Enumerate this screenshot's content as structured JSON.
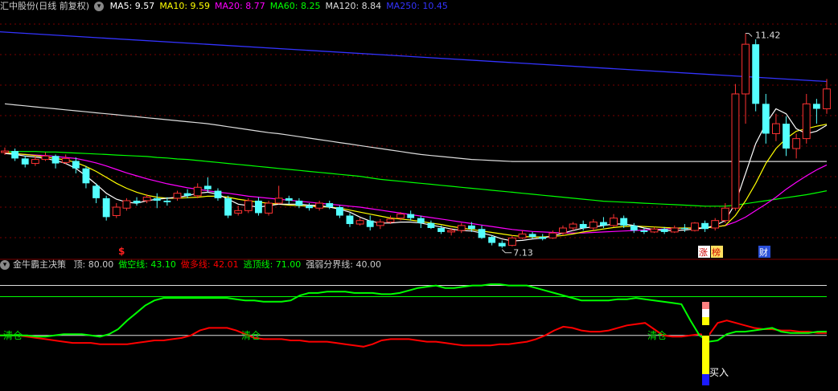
{
  "main_header": {
    "stock_title": "汇中股份(日线 前复权)",
    "ma_items": [
      {
        "label": "MA5: 9.57",
        "color": "#ffffff"
      },
      {
        "label": "MA10: 9.59",
        "color": "#ffff00"
      },
      {
        "label": "MA20: 8.77",
        "color": "#ff00ff"
      },
      {
        "label": "MA60: 8.25",
        "color": "#00ff00"
      },
      {
        "label": "MA120: 8.84",
        "color": "#dddddd"
      },
      {
        "label": "MA250: 10.45",
        "color": "#3333ff"
      }
    ]
  },
  "main_chart": {
    "high_label": "11.42",
    "low_label": "7.13",
    "markers": {
      "dollar": "$",
      "zhang": "涨",
      "bang": "榜",
      "cai": "财"
    },
    "colors": {
      "up": "#ff3232",
      "down": "#54ffff",
      "grid": "#7a0000"
    },
    "candles": [
      [
        9.02,
        9.05,
        9.12,
        8.97
      ],
      [
        9.05,
        8.9,
        9.1,
        8.85
      ],
      [
        8.9,
        8.78,
        8.96,
        8.72
      ],
      [
        8.8,
        8.88,
        8.95,
        8.75
      ],
      [
        8.88,
        8.95,
        9.02,
        8.85
      ],
      [
        8.95,
        8.8,
        8.98,
        8.7
      ],
      [
        8.82,
        8.9,
        8.98,
        8.78
      ],
      [
        8.85,
        8.7,
        8.92,
        8.6
      ],
      [
        8.7,
        8.4,
        8.75,
        8.3
      ],
      [
        8.35,
        8.1,
        8.4,
        8.0
      ],
      [
        8.1,
        7.72,
        8.15,
        7.65
      ],
      [
        7.75,
        7.92,
        8.0,
        7.7
      ],
      [
        7.9,
        8.05,
        8.1,
        7.85
      ],
      [
        8.05,
        8.0,
        8.12,
        7.95
      ],
      [
        8.05,
        8.12,
        8.18,
        8.0
      ],
      [
        8.1,
        8.05,
        8.2,
        7.9
      ],
      [
        8.05,
        8.02,
        8.12,
        7.95
      ],
      [
        8.1,
        8.2,
        8.25,
        8.05
      ],
      [
        8.2,
        8.15,
        8.28,
        8.1
      ],
      [
        8.15,
        8.32,
        8.4,
        8.1
      ],
      [
        8.35,
        8.28,
        8.52,
        8.22
      ],
      [
        8.25,
        8.1,
        8.3,
        8.05
      ],
      [
        8.1,
        7.75,
        8.15,
        7.7
      ],
      [
        7.8,
        7.85,
        7.95,
        7.75
      ],
      [
        7.85,
        8.05,
        8.1,
        7.8
      ],
      [
        8.05,
        7.8,
        8.12,
        7.75
      ],
      [
        7.8,
        8.0,
        8.05,
        7.75
      ],
      [
        8.0,
        8.1,
        8.35,
        7.98
      ],
      [
        8.1,
        8.05,
        8.15,
        7.98
      ],
      [
        8.05,
        7.95,
        8.1,
        7.9
      ],
      [
        7.95,
        7.9,
        8.0,
        7.85
      ],
      [
        7.9,
        8.0,
        8.05,
        7.85
      ],
      [
        8.0,
        7.92,
        8.05,
        7.88
      ],
      [
        7.92,
        7.75,
        7.95,
        7.7
      ],
      [
        7.75,
        7.58,
        7.8,
        7.52
      ],
      [
        7.58,
        7.65,
        7.7,
        7.55
      ],
      [
        7.65,
        7.52,
        7.75,
        7.45
      ],
      [
        7.55,
        7.62,
        7.68,
        7.48
      ],
      [
        7.62,
        7.68,
        7.75,
        7.58
      ],
      [
        7.7,
        7.78,
        7.82,
        7.65
      ],
      [
        7.78,
        7.7,
        7.85,
        7.65
      ],
      [
        7.7,
        7.6,
        7.75,
        7.5
      ],
      [
        7.6,
        7.5,
        7.65,
        7.48
      ],
      [
        7.5,
        7.42,
        7.55,
        7.38
      ],
      [
        7.42,
        7.45,
        7.5,
        7.35
      ],
      [
        7.45,
        7.55,
        7.6,
        7.4
      ],
      [
        7.55,
        7.48,
        7.62,
        7.42
      ],
      [
        7.48,
        7.3,
        7.55,
        7.28
      ],
      [
        7.32,
        7.2,
        7.35,
        7.15
      ],
      [
        7.2,
        7.13,
        7.25,
        7.1
      ],
      [
        7.15,
        7.3,
        7.35,
        7.13
      ],
      [
        7.3,
        7.38,
        7.45,
        7.28
      ],
      [
        7.38,
        7.32,
        7.42,
        7.28
      ],
      [
        7.32,
        7.28,
        7.38,
        7.25
      ],
      [
        7.3,
        7.4,
        7.45,
        7.28
      ],
      [
        7.4,
        7.5,
        7.55,
        7.35
      ],
      [
        7.5,
        7.58,
        7.62,
        7.45
      ],
      [
        7.58,
        7.5,
        7.65,
        7.45
      ],
      [
        7.5,
        7.62,
        7.68,
        7.45
      ],
      [
        7.62,
        7.55,
        7.72,
        7.5
      ],
      [
        7.55,
        7.7,
        7.78,
        7.52
      ],
      [
        7.7,
        7.55,
        7.75,
        7.5
      ],
      [
        7.55,
        7.45,
        7.6,
        7.4
      ],
      [
        7.45,
        7.42,
        7.5,
        7.38
      ],
      [
        7.42,
        7.48,
        7.52,
        7.4
      ],
      [
        7.48,
        7.42,
        7.52,
        7.38
      ],
      [
        7.42,
        7.5,
        7.55,
        7.4
      ],
      [
        7.5,
        7.48,
        7.58,
        7.42
      ],
      [
        7.45,
        7.6,
        7.62,
        7.43
      ],
      [
        7.6,
        7.48,
        7.65,
        7.42
      ],
      [
        7.5,
        7.65,
        7.7,
        7.45
      ],
      [
        7.65,
        7.9,
        8.0,
        7.6
      ],
      [
        7.9,
        10.2,
        10.4,
        7.85
      ],
      [
        10.2,
        11.2,
        11.42,
        9.6
      ],
      [
        11.2,
        10.0,
        11.3,
        9.85
      ],
      [
        10.0,
        9.4,
        10.2,
        9.2
      ],
      [
        9.4,
        9.6,
        9.8,
        9.25
      ],
      [
        9.6,
        9.1,
        9.75,
        8.95
      ],
      [
        9.1,
        9.3,
        9.4,
        8.9
      ],
      [
        9.3,
        10.0,
        10.2,
        9.2
      ],
      [
        10.0,
        9.9,
        10.1,
        9.6
      ],
      [
        9.9,
        10.3,
        10.5,
        9.8
      ]
    ],
    "ma5": [
      9.0,
      8.98,
      8.95,
      8.93,
      8.9,
      8.86,
      8.8,
      8.7,
      8.55,
      8.38,
      8.2,
      8.08,
      8.02,
      8.0,
      8.05,
      8.08,
      8.1,
      8.12,
      8.15,
      8.2,
      8.22,
      8.18,
      8.08,
      7.98,
      7.95,
      7.92,
      7.95,
      7.98,
      7.98,
      7.98,
      7.96,
      7.95,
      7.92,
      7.88,
      7.82,
      7.72,
      7.64,
      7.6,
      7.6,
      7.62,
      7.62,
      7.6,
      7.56,
      7.52,
      7.48,
      7.45,
      7.44,
      7.4,
      7.35,
      7.28,
      7.24,
      7.25,
      7.28,
      7.3,
      7.34,
      7.4,
      7.45,
      7.5,
      7.52,
      7.55,
      7.58,
      7.58,
      7.55,
      7.5,
      7.47,
      7.45,
      7.45,
      7.46,
      7.48,
      7.5,
      7.55,
      7.65,
      8.0,
      8.6,
      9.2,
      9.6,
      9.9,
      9.8,
      9.5,
      9.4,
      9.45,
      9.57
    ],
    "ma10": [
      9.02,
      9.0,
      8.98,
      8.96,
      8.93,
      8.9,
      8.87,
      8.82,
      8.74,
      8.64,
      8.52,
      8.4,
      8.3,
      8.22,
      8.16,
      8.12,
      8.1,
      8.1,
      8.11,
      8.12,
      8.14,
      8.14,
      8.12,
      8.08,
      8.05,
      8.02,
      8.0,
      7.98,
      7.96,
      7.95,
      7.94,
      7.93,
      7.92,
      7.9,
      7.86,
      7.82,
      7.78,
      7.74,
      7.7,
      7.68,
      7.66,
      7.63,
      7.6,
      7.57,
      7.53,
      7.5,
      7.47,
      7.44,
      7.41,
      7.38,
      7.35,
      7.33,
      7.32,
      7.32,
      7.33,
      7.35,
      7.38,
      7.42,
      7.45,
      7.48,
      7.51,
      7.53,
      7.54,
      7.53,
      7.52,
      7.51,
      7.5,
      7.5,
      7.5,
      7.5,
      7.52,
      7.55,
      7.75,
      8.05,
      8.4,
      8.8,
      9.1,
      9.3,
      9.45,
      9.5,
      9.55,
      9.59
    ],
    "ma20": [
      9.0,
      8.99,
      8.98,
      8.97,
      8.96,
      8.94,
      8.92,
      8.9,
      8.86,
      8.81,
      8.75,
      8.68,
      8.61,
      8.55,
      8.49,
      8.44,
      8.39,
      8.35,
      8.31,
      8.28,
      8.25,
      8.22,
      8.2,
      8.17,
      8.14,
      8.12,
      8.1,
      8.08,
      8.06,
      8.04,
      8.02,
      8.0,
      7.98,
      7.96,
      7.94,
      7.92,
      7.89,
      7.86,
      7.83,
      7.8,
      7.77,
      7.74,
      7.71,
      7.68,
      7.65,
      7.62,
      7.59,
      7.56,
      7.53,
      7.5,
      7.47,
      7.45,
      7.43,
      7.42,
      7.41,
      7.4,
      7.4,
      7.4,
      7.41,
      7.42,
      7.43,
      7.44,
      7.45,
      7.46,
      7.47,
      7.48,
      7.49,
      7.5,
      7.5,
      7.51,
      7.52,
      7.55,
      7.62,
      7.72,
      7.85,
      7.98,
      8.12,
      8.28,
      8.42,
      8.55,
      8.67,
      8.77
    ],
    "ma60": [
      9.04,
      9.04,
      9.04,
      9.04,
      9.03,
      9.03,
      9.02,
      9.01,
      9.0,
      8.99,
      8.98,
      8.97,
      8.96,
      8.95,
      8.94,
      8.92,
      8.91,
      8.89,
      8.88,
      8.86,
      8.84,
      8.82,
      8.8,
      8.78,
      8.76,
      8.74,
      8.72,
      8.7,
      8.68,
      8.66,
      8.64,
      8.62,
      8.6,
      8.58,
      8.56,
      8.54,
      8.51,
      8.48,
      8.46,
      8.44,
      8.42,
      8.4,
      8.38,
      8.36,
      8.34,
      8.32,
      8.3,
      8.28,
      8.26,
      8.24,
      8.22,
      8.2,
      8.18,
      8.16,
      8.14,
      8.12,
      8.1,
      8.08,
      8.06,
      8.04,
      8.03,
      8.02,
      8.01,
      8.0,
      7.99,
      7.98,
      7.97,
      7.96,
      7.95,
      7.94,
      7.94,
      7.94,
      7.96,
      7.99,
      8.02,
      8.05,
      8.08,
      8.11,
      8.14,
      8.17,
      8.21,
      8.25
    ],
    "ma120": [
      10.0,
      9.98,
      9.96,
      9.94,
      9.92,
      9.9,
      9.88,
      9.86,
      9.84,
      9.82,
      9.8,
      9.78,
      9.76,
      9.74,
      9.72,
      9.7,
      9.68,
      9.66,
      9.64,
      9.62,
      9.6,
      9.57,
      9.54,
      9.51,
      9.48,
      9.45,
      9.42,
      9.4,
      9.37,
      9.34,
      9.31,
      9.28,
      9.25,
      9.22,
      9.19,
      9.16,
      9.13,
      9.1,
      9.07,
      9.04,
      9.01,
      8.98,
      8.96,
      8.94,
      8.92,
      8.9,
      8.88,
      8.87,
      8.86,
      8.85,
      8.84,
      8.84,
      8.84,
      8.84,
      8.84,
      8.84,
      8.84,
      8.84,
      8.84,
      8.84,
      8.84,
      8.84,
      8.84,
      8.84,
      8.84,
      8.84,
      8.84,
      8.84,
      8.84,
      8.84,
      8.84,
      8.84,
      8.84,
      8.84,
      8.84,
      8.84,
      8.84,
      8.84,
      8.84,
      8.84,
      8.84,
      8.84
    ],
    "ma250_start": 11.45,
    "ma250_end": 10.45
  },
  "indicator_header": {
    "name": "金牛霸主决策",
    "items": [
      {
        "label": "顶: 80.00",
        "color": "#cccccc"
      },
      {
        "label": "做空线: 43.10",
        "color": "#00ff00"
      },
      {
        "label": "做多线: 42.01",
        "color": "#ff0000"
      },
      {
        "label": "逃顶线: 71.00",
        "color": "#00ff00"
      },
      {
        "label": "强弱分界线: 40.00",
        "color": "#cccccc"
      }
    ]
  },
  "indicator": {
    "top_value": 80,
    "escape_value": 71,
    "divider_value": 40,
    "clear_labels": [
      "清仓",
      "清仓",
      "清仓"
    ],
    "buy_label": "买入",
    "short_line": [
      40,
      40,
      40,
      40,
      39,
      39,
      40,
      41,
      41,
      41,
      40,
      39,
      41,
      45,
      52,
      58,
      64,
      68,
      70,
      70,
      70,
      70,
      70,
      70,
      70,
      70,
      69,
      68,
      68,
      67,
      67,
      67,
      68,
      72,
      74,
      74,
      75,
      75,
      75,
      74,
      74,
      74,
      73,
      73,
      74,
      76,
      78,
      79,
      80,
      78,
      78,
      79,
      80,
      80,
      81,
      81,
      80,
      80,
      80,
      78,
      76,
      74,
      72,
      70,
      68,
      68,
      68,
      68,
      69,
      69,
      70,
      69,
      68,
      67,
      66,
      65,
      52,
      40,
      35,
      36,
      41,
      43,
      43,
      44,
      45,
      46,
      43,
      42,
      42,
      42,
      43,
      43.1
    ],
    "long_line": [
      40,
      40,
      40,
      39,
      38,
      37,
      36,
      35,
      34,
      34,
      34,
      33,
      33,
      33,
      33,
      34,
      35,
      36,
      36,
      37,
      38,
      40,
      44,
      46,
      46,
      46,
      44,
      41,
      38,
      37,
      37,
      37,
      36,
      36,
      35,
      35,
      35,
      34,
      33,
      32,
      31,
      33,
      36,
      37,
      37,
      37,
      36,
      35,
      35,
      34,
      33,
      32,
      32,
      32,
      32,
      33,
      33,
      34,
      35,
      37,
      40,
      44,
      47,
      46,
      44,
      43,
      43,
      44,
      46,
      48,
      49,
      50,
      45,
      40,
      39,
      39,
      40,
      41,
      40,
      50,
      52,
      50,
      48,
      46,
      45,
      45,
      44,
      44,
      43,
      43,
      42,
      42.01
    ]
  }
}
